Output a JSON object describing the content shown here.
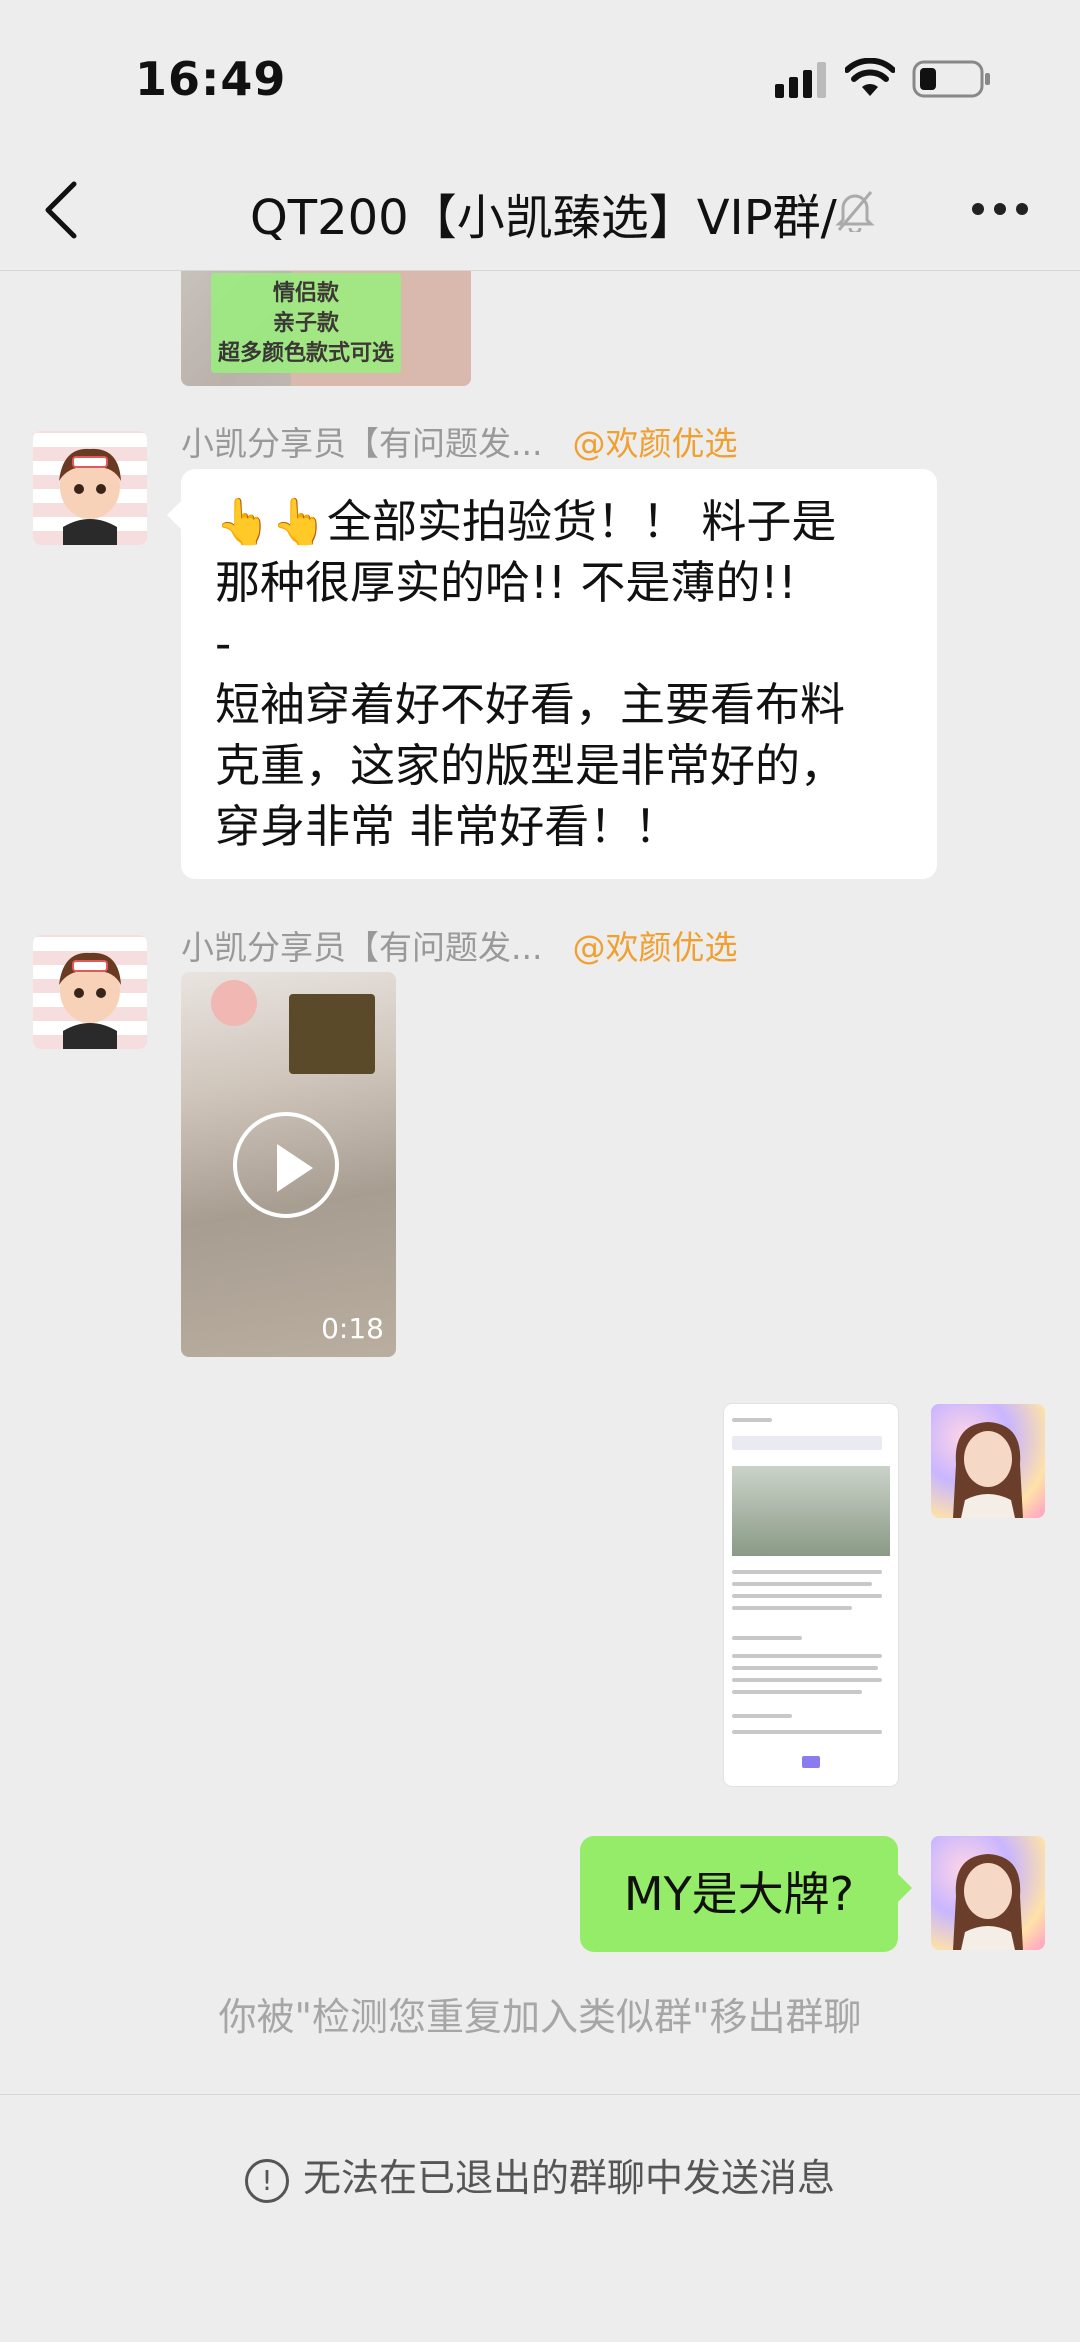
{
  "status_bar": {
    "time": "16:49",
    "icons": [
      "signal-icon",
      "wifi-icon",
      "battery-icon"
    ]
  },
  "nav": {
    "title": "QT200【小凯臻选】VIP群/",
    "back_icon": "chevron-left-icon",
    "mute_icon": "bell-off-icon",
    "more_icon": "more-dots-icon"
  },
  "messages": [
    {
      "type": "image",
      "side": "left",
      "overlay_text": [
        "情侣款",
        "亲子款",
        "超多颜色款式可选"
      ]
    },
    {
      "type": "text",
      "side": "left",
      "sender": "小凯分享员【有问题发...",
      "mention": "@欢颜优选",
      "lines": [
        "👆👆全部实拍验货！！ 料子是",
        "那种很厚实的哈!! 不是薄的!!",
        "-",
        "短袖穿着好不好看，主要看布料",
        "克重，这家的版型是非常好的，",
        "穿身非常 非常好看！！"
      ]
    },
    {
      "type": "video",
      "side": "left",
      "sender": "小凯分享员【有问题发...",
      "mention": "@欢颜优选",
      "duration": "0:18"
    },
    {
      "type": "image",
      "side": "right"
    },
    {
      "type": "text",
      "side": "right",
      "text": "MY是大牌?"
    }
  ],
  "system_message": "你被\"检测您重复加入类似群\"移出群聊",
  "footer": {
    "message": "无法在已退出的群聊中发送消息",
    "icon": "info-circle-icon"
  },
  "colors": {
    "background": "#ededed",
    "self_bubble": "#95ec69",
    "mention": "#f0a030"
  }
}
